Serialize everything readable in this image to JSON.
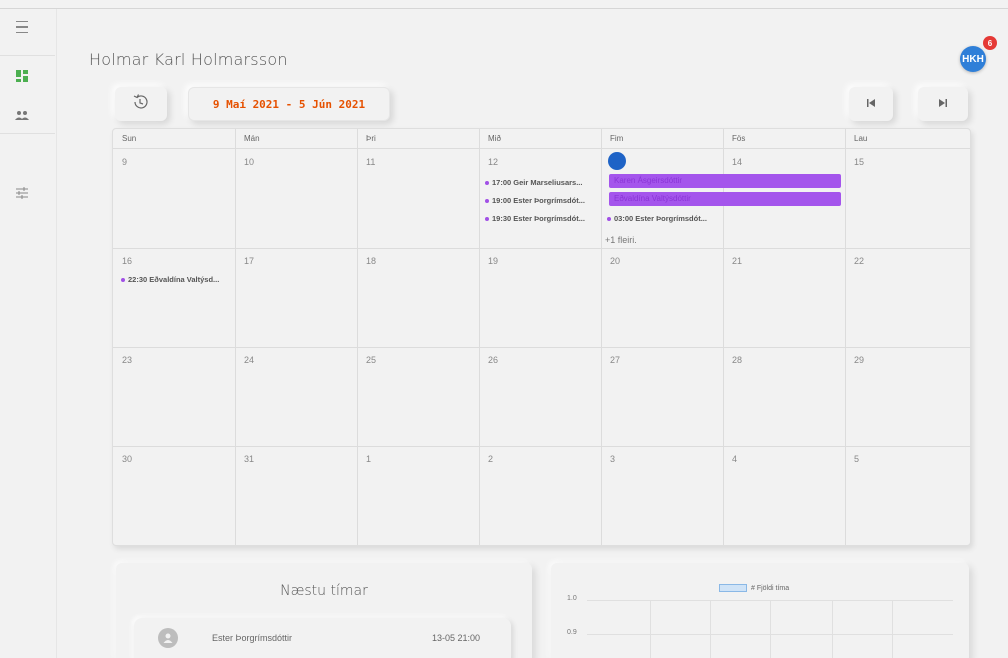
{
  "user": {
    "name": "Holmar Karl Holmarsson",
    "initials": "HKH",
    "notifications": "6"
  },
  "nav": {
    "menu_icon": "menu-icon",
    "items": [
      {
        "icon": "dashboard-icon",
        "active": true
      },
      {
        "icon": "people-icon",
        "active": false
      },
      {
        "icon": "sliders-icon",
        "active": false
      }
    ]
  },
  "toolbar": {
    "range": "9 Maí 2021 - 5 Jún 2021",
    "history_icon": "history-icon",
    "prev_icon": "skip-previous-icon",
    "next_icon": "skip-next-icon"
  },
  "calendar": {
    "weekdays": [
      "Sun",
      "Mán",
      "Þri",
      "Mið",
      "Fim",
      "Fös",
      "Lau"
    ],
    "weeks": [
      [
        "9",
        "10",
        "11",
        "12",
        "13",
        "14",
        "15"
      ],
      [
        "16",
        "17",
        "18",
        "19",
        "20",
        "21",
        "22"
      ],
      [
        "23",
        "24",
        "25",
        "26",
        "27",
        "28",
        "29"
      ],
      [
        "30",
        "31",
        "1",
        "2",
        "3",
        "4",
        "5"
      ]
    ],
    "today": "13",
    "events": {
      "wed12": [
        "17:00 Geir Marseliusars...",
        "19:00 Ester Þorgrímsdót...",
        "19:30 Ester Þorgrímsdót..."
      ],
      "thu13_allday": [
        "Karen Ásgeirsdóttir",
        "Eðvaldína Valtýsdóttir"
      ],
      "thu13": [
        "03:00 Ester Þorgrímsdót..."
      ],
      "thu13_more": "+1 fleiri.",
      "sun16": [
        "22:30 Eðvaldína Valtýsd..."
      ]
    }
  },
  "upcoming": {
    "title": "Næstu tímar",
    "items": [
      {
        "name": "Ester Þorgrímsdóttir",
        "time": "13-05 21:00"
      }
    ]
  },
  "chart_data": {
    "type": "bar",
    "series": [
      {
        "name": "# Fjöldi tíma",
        "values": []
      }
    ],
    "yticks": [
      "1.0",
      "0.9"
    ],
    "color": "#cfe3f7"
  }
}
